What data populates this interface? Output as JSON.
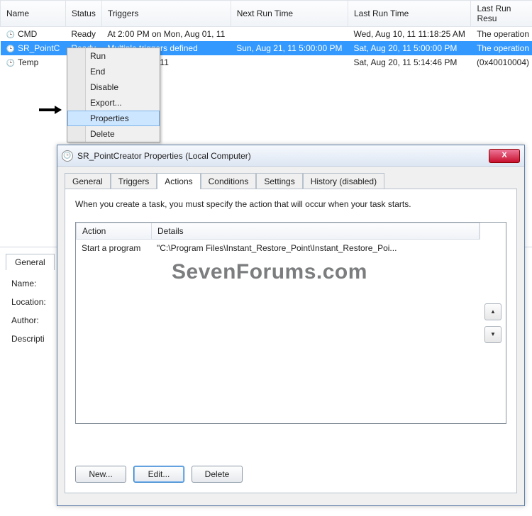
{
  "grid": {
    "cols": [
      "Name",
      "Status",
      "Triggers",
      "Next Run Time",
      "Last Run Time",
      "Last Run Resu"
    ],
    "rows": [
      {
        "name": "CMD",
        "status": "Ready",
        "triggers": "At 2:00 PM on Mon, Aug 01, 11",
        "next": "",
        "last": "Wed, Aug 10, 11 11:18:25 AM",
        "result": "The operation"
      },
      {
        "name": "SR_PointC",
        "status": "Ready",
        "triggers": "Multiple triggers defined",
        "next": "Sun, Aug 21, 11 5:00:00 PM",
        "last": "Sat, Aug 20, 11 5:00:00 PM",
        "result": "The operation",
        "selected": true
      },
      {
        "name": "Temp",
        "status": "",
        "triggers": "Mon, Aug 01, 11",
        "next": "",
        "last": "Sat, Aug 20, 11 5:14:46 PM",
        "result": "(0x40010004)"
      }
    ]
  },
  "context": {
    "items": [
      "Run",
      "End",
      "Disable",
      "Export...",
      "Properties",
      "Delete"
    ],
    "hover": "Properties"
  },
  "panel": {
    "tab": "General",
    "labels": [
      "Name:",
      "Location:",
      "Author:",
      "Descripti"
    ]
  },
  "dialog": {
    "title": "SR_PointCreator Properties (Local Computer)",
    "close": "X",
    "tabs": [
      "General",
      "Triggers",
      "Actions",
      "Conditions",
      "Settings",
      "History (disabled)"
    ],
    "active": "Actions",
    "desc": "When you create a task, you must specify the action that will occur when your task starts.",
    "cols": {
      "action": "Action",
      "details": "Details"
    },
    "item": {
      "action": "Start a program",
      "details": "\"C:\\Program Files\\Instant_Restore_Point\\Instant_Restore_Poi..."
    },
    "up": "▲",
    "down": "▼",
    "buttons": {
      "new": "New...",
      "edit": "Edit...",
      "del": "Delete"
    }
  },
  "watermark": "SevenForums.com"
}
